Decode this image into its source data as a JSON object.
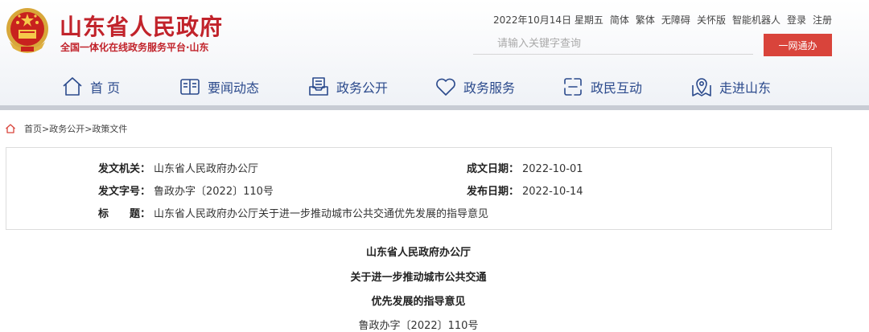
{
  "header": {
    "site_title": "山东省人民政府",
    "site_subtitle": "全国一体化在线政务服务平台·山东",
    "date": "2022年10月14日 星期五",
    "links": [
      "简体",
      "繁体",
      "无障碍",
      "关怀版",
      "智能机器人",
      "登录",
      "注册"
    ],
    "search_placeholder": "请输入关键字查询",
    "oneweb_label": "一网通办",
    "accent_color": "#c1232b"
  },
  "nav": {
    "items": [
      {
        "label": "首 页",
        "icon": "home-icon"
      },
      {
        "label": "要闻动态",
        "icon": "news-icon"
      },
      {
        "label": "政务公开",
        "icon": "inbox-icon"
      },
      {
        "label": "政务服务",
        "icon": "heart-icon"
      },
      {
        "label": "政民互动",
        "icon": "interact-icon"
      },
      {
        "label": "走进山东",
        "icon": "location-icon"
      }
    ],
    "color": "#2b4a8c"
  },
  "breadcrumb": {
    "home": "首页",
    "sep": ">",
    "level1": "政务公开",
    "level2": "政策文件"
  },
  "info": {
    "issuer_label": "发文机关：",
    "issuer_value": "山东省人民政府办公厅",
    "doc_no_label": "发文字号：",
    "doc_no_value": "鲁政办字〔2022〕110号",
    "title_label": "标　　题：",
    "title_value": "山东省人民政府办公厅关于进一步推动城市公共交通优先发展的指导意见",
    "created_label": "成文日期：",
    "created_value": "2022-10-01",
    "published_label": "发布日期：",
    "published_value": "2022-10-14"
  },
  "document": {
    "line1": "山东省人民政府办公厅",
    "line2": "关于进一步推动城市公共交通",
    "line3": "优先发展的指导意见",
    "number": "鲁政办字〔2022〕110号"
  }
}
